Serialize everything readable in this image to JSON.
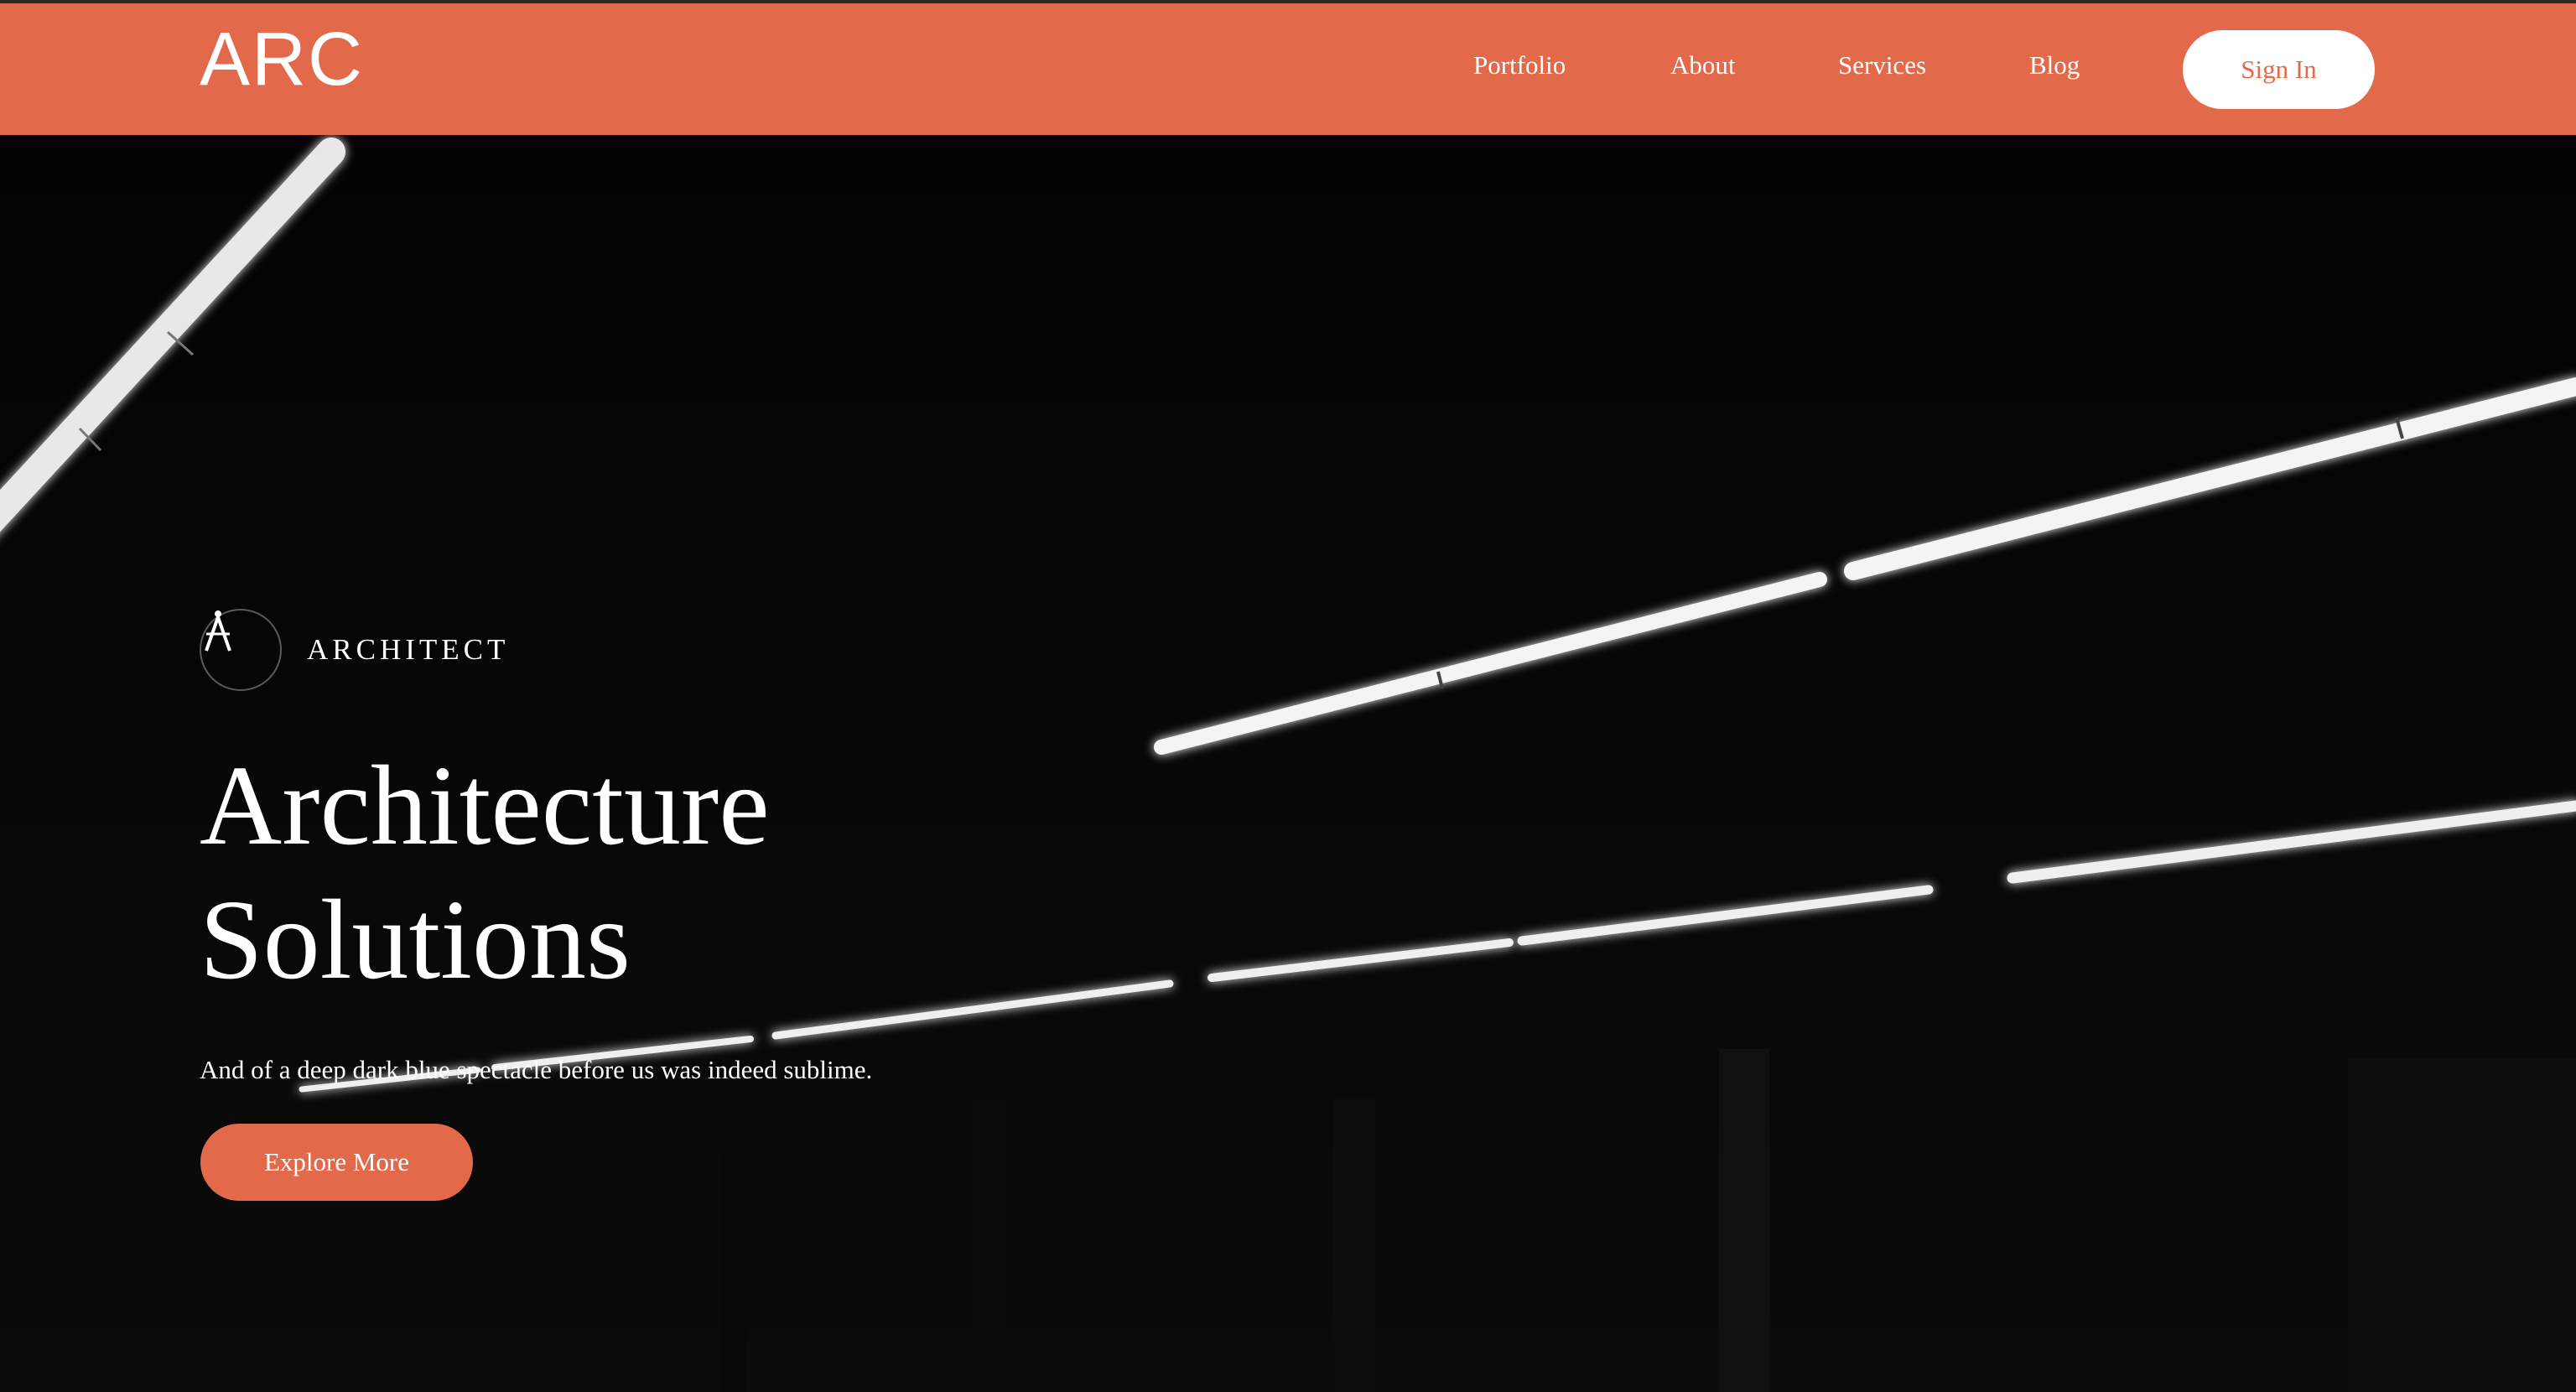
{
  "header": {
    "logo": "ARC",
    "nav": [
      "Portfolio",
      "About",
      "Services",
      "Blog"
    ],
    "sign_in": "Sign In"
  },
  "hero": {
    "badge": "ARCHITECT",
    "badge_icon": "compass-icon",
    "title_line1": "Architecture",
    "title_line2": "Solutions",
    "subtitle": "And of a deep dark blue spectacle before us was indeed sublime.",
    "cta": "Explore More"
  },
  "colors": {
    "accent": "#e26a4a",
    "background": "#000000",
    "text": "#ffffff"
  }
}
